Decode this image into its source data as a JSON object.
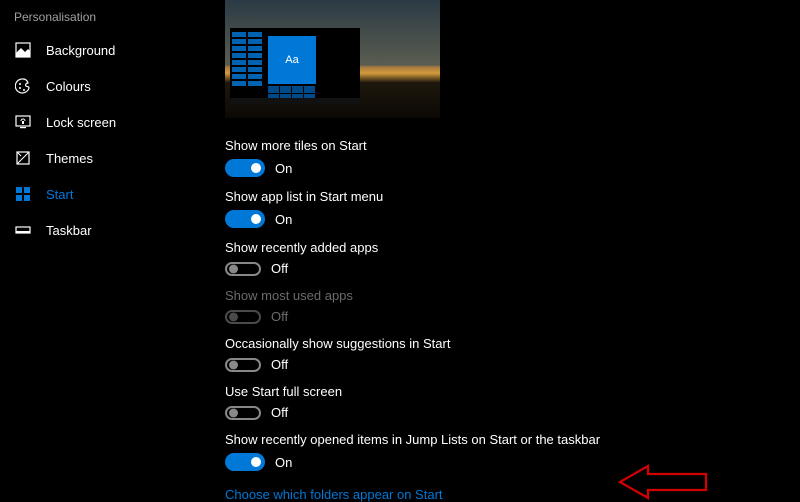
{
  "sidebar": {
    "title": "Personalisation",
    "items": [
      {
        "label": "Background",
        "icon": "background-icon",
        "active": false
      },
      {
        "label": "Colours",
        "icon": "colours-icon",
        "active": false
      },
      {
        "label": "Lock screen",
        "icon": "lock-screen-icon",
        "active": false
      },
      {
        "label": "Themes",
        "icon": "themes-icon",
        "active": false
      },
      {
        "label": "Start",
        "icon": "start-icon",
        "active": true
      },
      {
        "label": "Taskbar",
        "icon": "taskbar-icon",
        "active": false
      }
    ]
  },
  "preview": {
    "sample_text": "Aa"
  },
  "settings": [
    {
      "label": "Show more tiles on Start",
      "on": true,
      "state": "On",
      "disabled": false
    },
    {
      "label": "Show app list in Start menu",
      "on": true,
      "state": "On",
      "disabled": false
    },
    {
      "label": "Show recently added apps",
      "on": false,
      "state": "Off",
      "disabled": false
    },
    {
      "label": "Show most used apps",
      "on": false,
      "state": "Off",
      "disabled": true
    },
    {
      "label": "Occasionally show suggestions in Start",
      "on": false,
      "state": "Off",
      "disabled": false
    },
    {
      "label": "Use Start full screen",
      "on": false,
      "state": "Off",
      "disabled": false
    },
    {
      "label": "Show recently opened items in Jump Lists on Start or the taskbar",
      "on": true,
      "state": "On",
      "disabled": false
    }
  ],
  "link": {
    "label": "Choose which folders appear on Start"
  },
  "colors": {
    "accent": "#0078d7",
    "annotation": "#d40000"
  }
}
